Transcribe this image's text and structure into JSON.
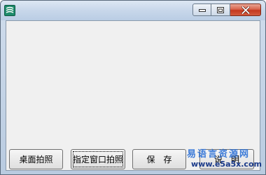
{
  "window": {
    "icon": "app-icon",
    "controls": {
      "minimize_icon": "minimize-icon",
      "maximize_icon": "maximize-icon",
      "close_icon": "close-icon"
    }
  },
  "buttons": {
    "desktop_capture": "桌面拍照",
    "window_capture": "指定窗口拍照",
    "save": "保　存",
    "about": "说　明"
  },
  "watermark": {
    "text": "易语言资源网",
    "url": "www.e5a5x.com"
  },
  "colors": {
    "close_button": "#c4381f",
    "client_background": "#f0f0f0",
    "watermark": "#2a6fd6"
  }
}
